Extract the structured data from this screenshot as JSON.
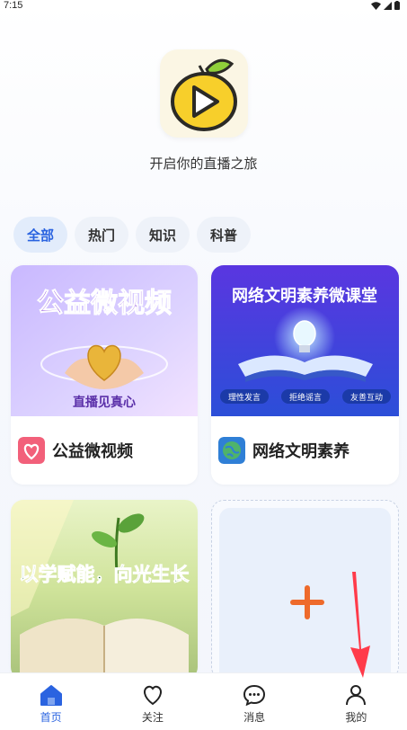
{
  "status_bar": {
    "time": "7:15"
  },
  "header": {
    "slogan": "开启你的直播之旅"
  },
  "tabs": [
    {
      "label": "全部",
      "active": true
    },
    {
      "label": "热门",
      "active": false
    },
    {
      "label": "知识",
      "active": false
    },
    {
      "label": "科普",
      "active": false
    }
  ],
  "cards": [
    {
      "title": "公益微视频",
      "banner_title": "公益微视频",
      "banner_subtitle": "直播见真心",
      "icon": "heart-icon"
    },
    {
      "title": "网络文明素养",
      "banner_title": "网络文明素养微课堂",
      "banner_tags": [
        "理性发言",
        "拒绝谣言",
        "友善互动"
      ],
      "icon": "globe-icon"
    },
    {
      "banner_title": "以学赋能，向光生长"
    }
  ],
  "add_card": {
    "icon": "plus-icon"
  },
  "bottom_nav": [
    {
      "label": "首页",
      "icon": "home-icon",
      "active": true
    },
    {
      "label": "关注",
      "icon": "heart-outline-icon",
      "active": false
    },
    {
      "label": "消息",
      "icon": "message-icon",
      "active": false
    },
    {
      "label": "我的",
      "icon": "person-icon",
      "active": false
    }
  ],
  "colors": {
    "accent": "#2a63e0",
    "plus": "#ee6a2b",
    "arrow": "#ff3b4a"
  }
}
